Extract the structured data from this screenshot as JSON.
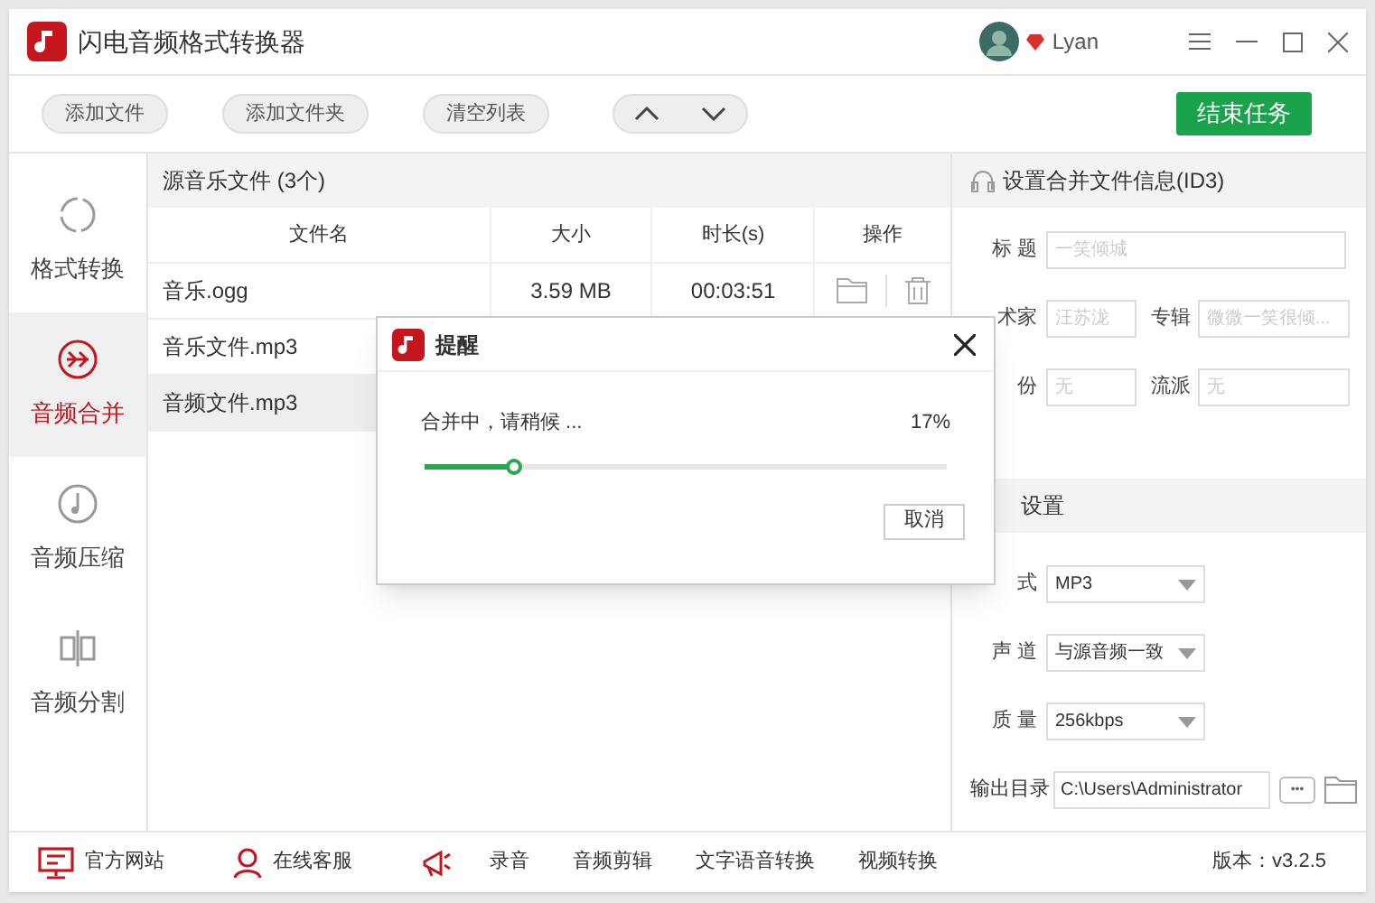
{
  "window": {
    "title": "闪电音频格式转换器",
    "user": "Lyan"
  },
  "toolbar": {
    "buttons": [
      "添加文件",
      "添加文件夹",
      "清空列表"
    ],
    "end_button": "结束任务"
  },
  "sidebar": {
    "items": [
      {
        "label": "格式转换",
        "kind": "convert",
        "selected": false
      },
      {
        "label": "音频合并",
        "kind": "merge",
        "selected": true
      },
      {
        "label": "音频压缩",
        "kind": "compress",
        "selected": false
      },
      {
        "label": "音频分割",
        "kind": "split",
        "selected": false
      }
    ]
  },
  "file_list": {
    "title": "源音乐文件 (3个)",
    "columns": [
      "文件名",
      "大小",
      "时长(s)",
      "操作"
    ],
    "rows": [
      {
        "name": "音乐.ogg",
        "size": "3.59 MB",
        "duration": "00:03:51",
        "selected": false,
        "actions": true
      },
      {
        "name": "音乐文件.mp3",
        "selected": false
      },
      {
        "name": "音频文件.mp3",
        "selected": true
      }
    ]
  },
  "id3_panel": {
    "title": "设置合并文件信息(ID3)",
    "rows": [
      [
        {
          "label": "标 题",
          "placeholder": "一笑倾城"
        }
      ],
      [
        {
          "label": "术家",
          "placeholder": "汪苏泷"
        },
        {
          "label": "专辑",
          "placeholder": "微微一笑很倾..."
        }
      ],
      [
        {
          "label": "份",
          "placeholder": "无"
        },
        {
          "label": "流派",
          "placeholder": "无"
        }
      ]
    ]
  },
  "output_panel": {
    "title": "设置",
    "selects": [
      {
        "label": "式",
        "value": "MP3"
      },
      {
        "label": "声 道",
        "value": "与源音频一致"
      },
      {
        "label": "质 量",
        "value": "256kbps"
      }
    ],
    "directory": {
      "label": "输出目录",
      "value": "C:\\Users\\Administrator",
      "browse": "•••"
    }
  },
  "dialog": {
    "title": "提醒",
    "message": "合并中，请稍候 ...",
    "percent": "17%",
    "level": 0.17,
    "cancel": "取消"
  },
  "footer": {
    "links": [
      {
        "label": "官方网站",
        "kind": "monitor"
      },
      {
        "label": "在线客服",
        "kind": "person"
      },
      {
        "kind": "megaphone"
      },
      {
        "label": "录音",
        "kind": "text"
      },
      {
        "label": "音频剪辑",
        "kind": "text"
      },
      {
        "label": "文字语音转换",
        "kind": "text"
      },
      {
        "label": "视频转换",
        "kind": "text"
      }
    ],
    "version": "版本：v3.2.5"
  }
}
